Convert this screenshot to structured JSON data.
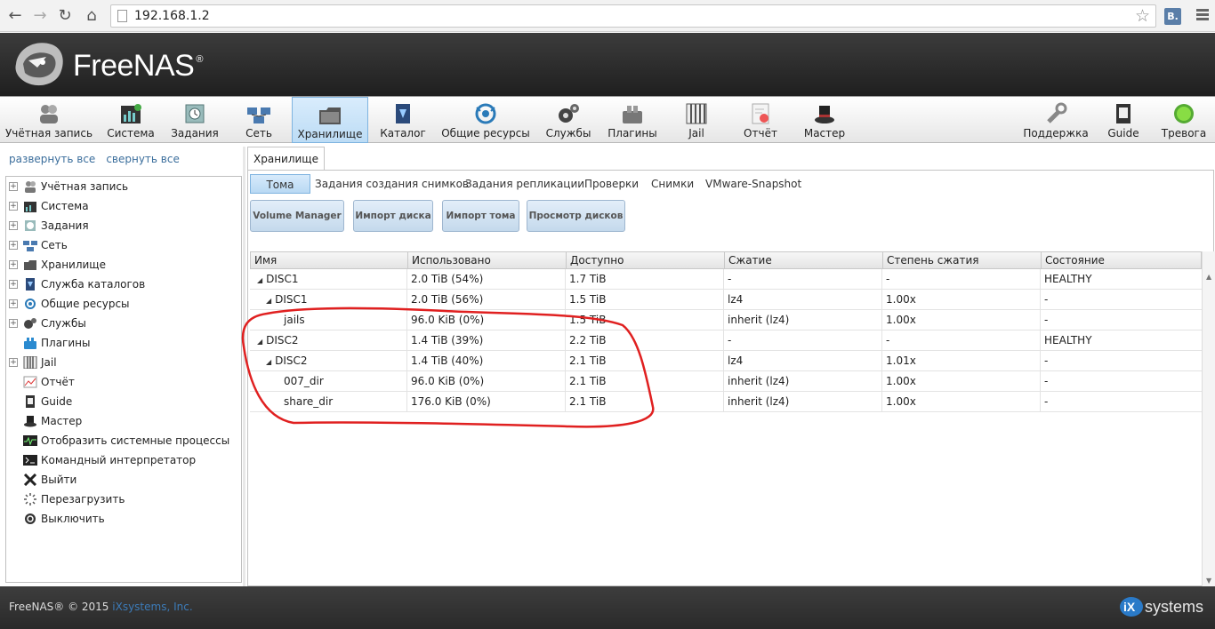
{
  "browser": {
    "url": "192.168.1.2",
    "extension_label": "B."
  },
  "brand": {
    "name": "FreeNAS",
    "reg": "®"
  },
  "toolbar": [
    {
      "label": "Учётная запись",
      "icon": "account-icon"
    },
    {
      "label": "Система",
      "icon": "system-icon"
    },
    {
      "label": "Задания",
      "icon": "tasks-icon"
    },
    {
      "label": "Сеть",
      "icon": "network-icon"
    },
    {
      "label": "Хранилище",
      "icon": "storage-icon",
      "active": true
    },
    {
      "label": "Каталог",
      "icon": "directory-icon"
    },
    {
      "label": "Общие ресурсы",
      "icon": "sharing-icon"
    },
    {
      "label": "Службы",
      "icon": "services-icon"
    },
    {
      "label": "Плагины",
      "icon": "plugins-icon"
    },
    {
      "label": "Jail",
      "icon": "jail-icon"
    },
    {
      "label": "Отчёт",
      "icon": "report-icon"
    },
    {
      "label": "Мастер",
      "icon": "wizard-icon"
    },
    {
      "label": "Поддержка",
      "icon": "support-icon"
    },
    {
      "label": "Guide",
      "icon": "guide-icon"
    },
    {
      "label": "Тревога",
      "icon": "alert-icon"
    }
  ],
  "sidebar": {
    "expand_all": "развернуть все",
    "collapse_all": "свернуть все",
    "items": [
      {
        "label": "Учётная запись",
        "expandable": true
      },
      {
        "label": "Система",
        "expandable": true
      },
      {
        "label": "Задания",
        "expandable": true
      },
      {
        "label": "Сеть",
        "expandable": true
      },
      {
        "label": "Хранилище",
        "expandable": true
      },
      {
        "label": "Служба каталогов",
        "expandable": true
      },
      {
        "label": "Общие ресурсы",
        "expandable": true
      },
      {
        "label": "Службы",
        "expandable": true
      },
      {
        "label": "Плагины",
        "expandable": false
      },
      {
        "label": "Jail",
        "expandable": true
      },
      {
        "label": "Отчёт",
        "expandable": false
      },
      {
        "label": "Guide",
        "expandable": false
      },
      {
        "label": "Мастер",
        "expandable": false
      },
      {
        "label": "Отобразить системные процессы",
        "expandable": false
      },
      {
        "label": "Командный интерпретатор",
        "expandable": false
      },
      {
        "label": "Выйти",
        "expandable": false
      },
      {
        "label": "Перезагрузить",
        "expandable": false
      },
      {
        "label": "Выключить",
        "expandable": false
      }
    ]
  },
  "main": {
    "tab": "Хранилище",
    "subtabs": [
      "Тома",
      "Задания создания снимков",
      "Задания репликации",
      "Проверки",
      "Снимки",
      "VMware-Snapshot"
    ],
    "buttons": [
      "Volume Manager",
      "Импорт диска",
      "Импорт тома",
      "Просмотр дисков"
    ],
    "columns": [
      "Имя",
      "Использовано",
      "Доступно",
      "Сжатие",
      "Степень сжатия",
      "Состояние"
    ],
    "rows": [
      {
        "name": "DISC1",
        "used": "2.0 TiB (54%)",
        "avail": "1.7 TiB",
        "comp": "-",
        "ratio": "-",
        "status": "HEALTHY"
      },
      {
        "name": "DISC1",
        "used": "2.0 TiB (56%)",
        "avail": "1.5 TiB",
        "comp": "lz4",
        "ratio": "1.00x",
        "status": "-"
      },
      {
        "name": "jails",
        "used": "96.0 KiB (0%)",
        "avail": "1.5 TiB",
        "comp": "inherit (lz4)",
        "ratio": "1.00x",
        "status": "-"
      },
      {
        "name": "DISC2",
        "used": "1.4 TiB (39%)",
        "avail": "2.2 TiB",
        "comp": "-",
        "ratio": "-",
        "status": "HEALTHY"
      },
      {
        "name": "DISC2",
        "used": "1.4 TiB (40%)",
        "avail": "2.1 TiB",
        "comp": "lz4",
        "ratio": "1.01x",
        "status": "-"
      },
      {
        "name": "007_dir",
        "used": "96.0 KiB (0%)",
        "avail": "2.1 TiB",
        "comp": "inherit (lz4)",
        "ratio": "1.00x",
        "status": "-"
      },
      {
        "name": "share_dir",
        "used": "176.0 KiB (0%)",
        "avail": "2.1 TiB",
        "comp": "inherit (lz4)",
        "ratio": "1.00x",
        "status": "-"
      }
    ]
  },
  "footer": {
    "copyright": "FreeNAS® © 2015",
    "company": "iXsystems, Inc.",
    "vendor_logo_ix": "iX",
    "vendor_logo_text": "systems"
  },
  "colors": {
    "annotation": "#e02020",
    "active_blue": "#7fb4e0",
    "link": "#3b6e9c"
  }
}
